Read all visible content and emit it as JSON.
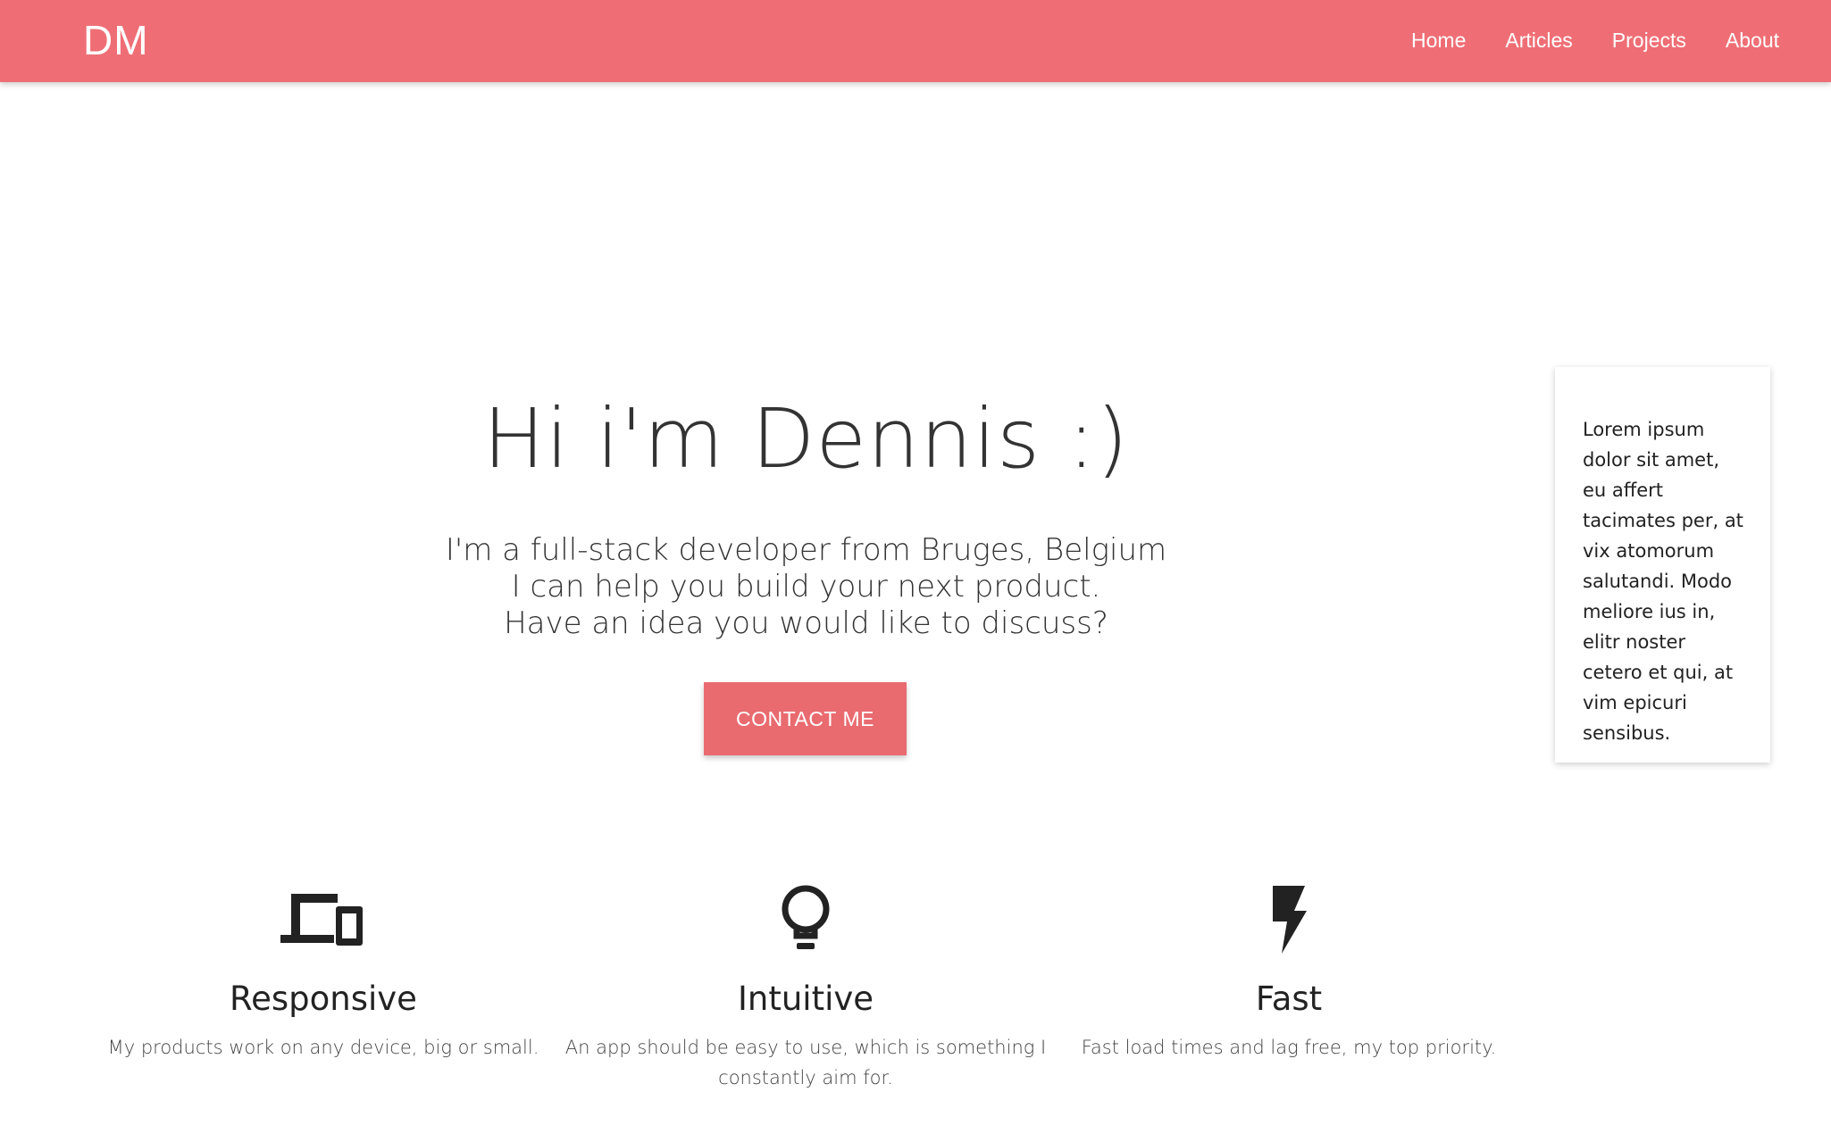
{
  "navbar": {
    "brand": "DM",
    "links": [
      "Home",
      "Articles",
      "Projects",
      "About"
    ],
    "color": "#ef6e75"
  },
  "hero": {
    "title": "Hi i'm Dennis :)",
    "subtitle_lines": [
      "I'm a full-stack developer from Bruges, Belgium",
      "I can help you build your next product.",
      "Have an idea you would like to discuss?"
    ],
    "contact_button": "CONTACT ME"
  },
  "side_card": {
    "text": "Lorem ipsum dolor sit amet, eu affert tacimates per, at vix atomorum salutandi. Modo meliore ius in, elitr noster cetero et qui, at vim epicuri sensibus."
  },
  "features": [
    {
      "icon": "devices-icon",
      "title": "Responsive",
      "description": "My products work on any device, big or small."
    },
    {
      "icon": "lightbulb-icon",
      "title": "Intuitive",
      "description": "An app should be easy to use, which is something I constantly aim for."
    },
    {
      "icon": "flash-icon",
      "title": "Fast",
      "description": "Fast load times and lag free, my top priority."
    }
  ]
}
